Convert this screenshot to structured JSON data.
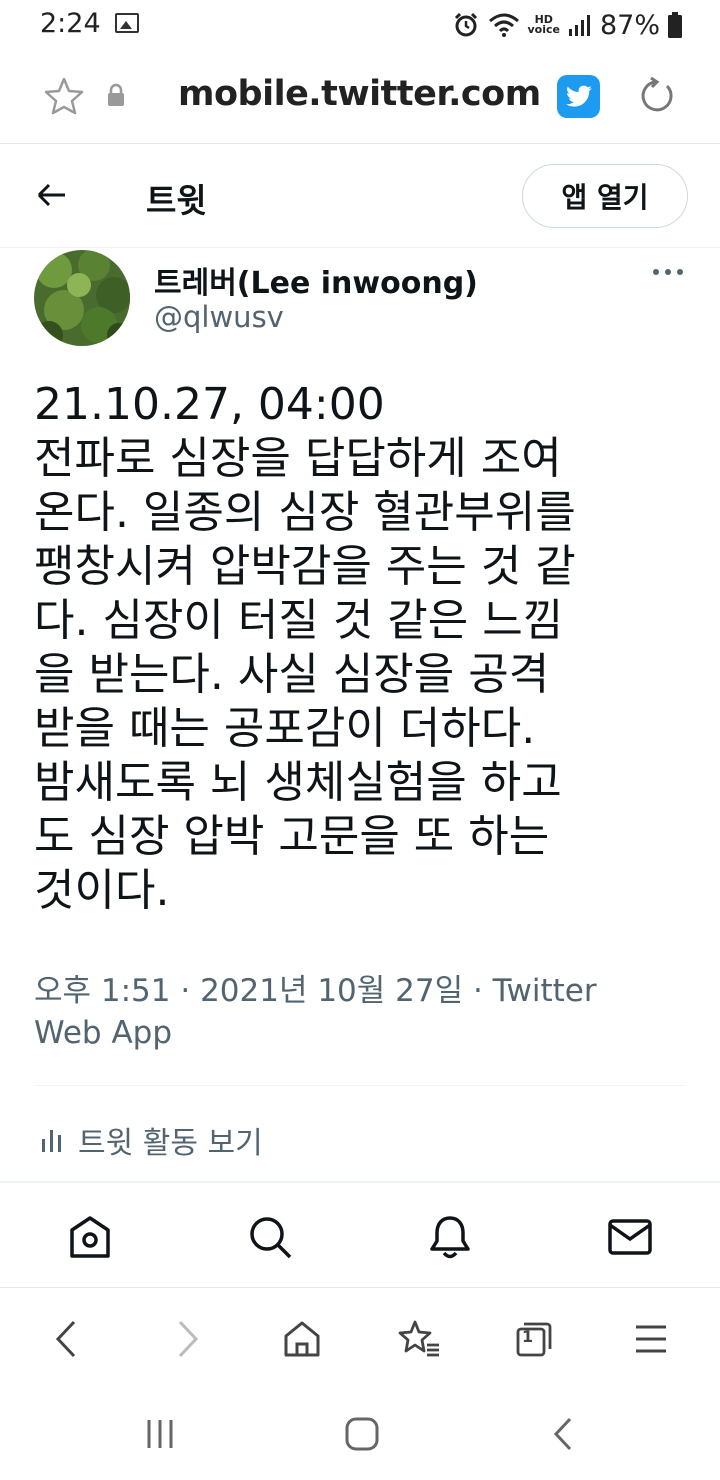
{
  "status_bar": {
    "time": "2:24",
    "battery": "87%",
    "hd_voice": "HD\nvoice",
    "icons": [
      "gallery-icon",
      "alarm-icon",
      "wifi-icon",
      "hd-voice-icon",
      "signal-icon",
      "battery-icon"
    ]
  },
  "browser": {
    "url": "mobile.twitter.com",
    "icons": [
      "star-icon",
      "lock-icon",
      "twitter-icon",
      "reload-icon"
    ]
  },
  "header": {
    "title": "트윗",
    "open_app_label": "앱 열기"
  },
  "tweet": {
    "display_name": "트레버(Lee inwoong)",
    "handle": "@qlwusv",
    "text": "21.10.27, 04:00\n전파로 심장을 답답하게 조여\n온다. 일종의 심장 혈관부위를\n팽창시켜 압박감을 주는 것 같\n다. 심장이 터질 것 같은 느낌\n을 받는다. 사실 심장을 공격\n받을 때는 공포감이 더하다.\n밤새도록 뇌 생체실험을 하고\n도 심장 압박 고문을 또 하는\n것이다.",
    "meta": "오후 1:51 · 2021년 10월 27일 · Twitter Web App",
    "activity_label": "트윗 활동 보기"
  },
  "bottom_nav": [
    "home-icon",
    "search-icon",
    "notifications-icon",
    "messages-icon"
  ],
  "browser_nav": {
    "tab_count": "1",
    "icons": [
      "back-icon",
      "forward-icon",
      "browser-home-icon",
      "bookmarks-icon",
      "tabs-icon",
      "menu-icon"
    ]
  },
  "colors": {
    "twitter_blue": "#1d9bf0",
    "text_primary": "#0f1419",
    "text_secondary": "#536471",
    "border": "#cfd9de"
  }
}
